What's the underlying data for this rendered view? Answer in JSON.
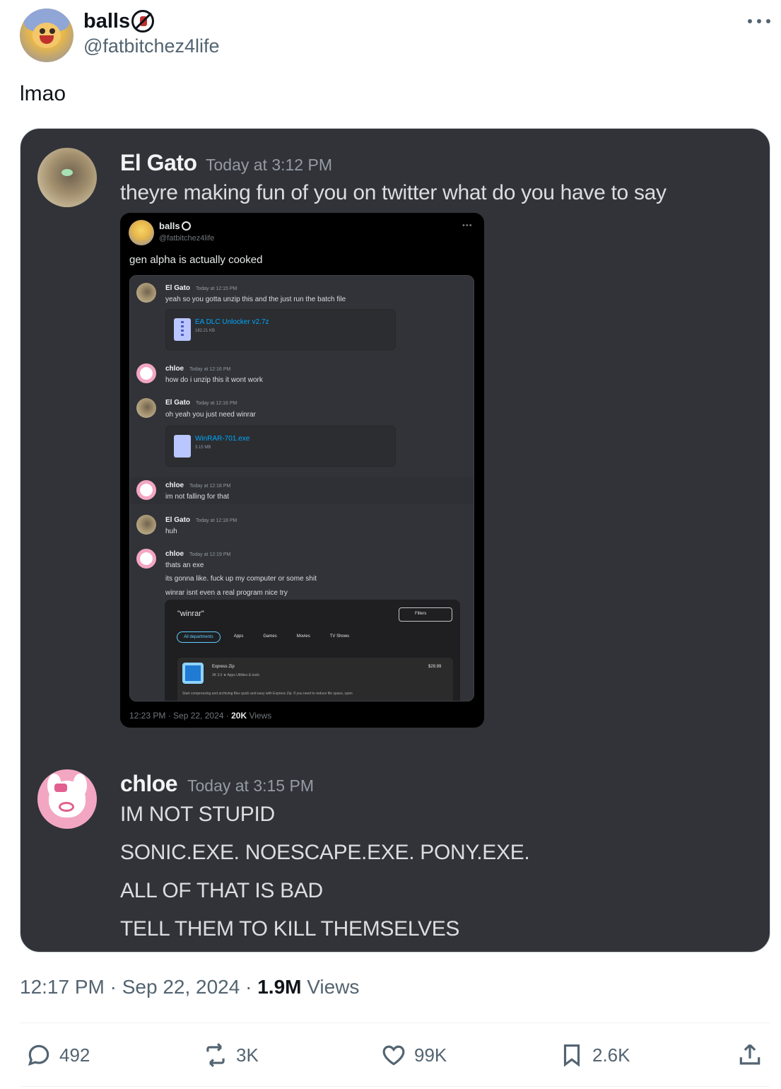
{
  "tweet": {
    "author": {
      "display_name": "balls",
      "handle": "@fatbitchez4life"
    },
    "text": "lmao",
    "timestamp": "12:17 PM · Sep 22, 2024 · ",
    "views_count": "1.9M",
    "views_label": " Views",
    "actions": {
      "replies": "492",
      "reposts": "3K",
      "likes": "99K",
      "bookmarks": "2.6K"
    }
  },
  "discord": {
    "messages": [
      {
        "author": "El Gato",
        "time": "Today at 3:12 PM",
        "lines": [
          "theyre making fun of you on twitter what do you have to say"
        ]
      },
      {
        "author": "chloe",
        "time": "Today at 3:15 PM",
        "lines": [
          "IM NOT STUPID",
          "SONIC.EXE. NOESCAPE.EXE. PONY.EXE.",
          "ALL OF THAT IS BAD",
          "TELL THEM TO KILL THEMSELVES"
        ]
      }
    ]
  },
  "nested_tweet": {
    "display_name": "balls",
    "handle": "@fatbitchez4life",
    "more": "•••",
    "text": "gen alpha is actually cooked",
    "footer_prefix": "12:23 PM · Sep 22, 2024 · ",
    "footer_views": "20K",
    "footer_suffix": " Views",
    "chat": [
      {
        "author": "El Gato",
        "time": "Today at 12:15 PM",
        "lines": [
          "yeah so you gotta unzip this and the just run the batch file"
        ]
      },
      {
        "file": "EA DLC Unlocker v2.7z",
        "size": "182.21 KB"
      },
      {
        "author": "chloe",
        "time": "Today at 12:16 PM",
        "lines": [
          "how do i unzip this it wont work"
        ]
      },
      {
        "author": "El Gato",
        "time": "Today at 12:16 PM",
        "lines": [
          "oh yeah you just need winrar"
        ]
      },
      {
        "file": "WinRAR-701.exe",
        "size": "3.15 MB"
      },
      {
        "author": "chloe",
        "time": "Today at 12:18 PM",
        "lines": [
          "im not falling for that"
        ]
      },
      {
        "author": "El Gato",
        "time": "Today at 12:18 PM",
        "lines": [
          "huh"
        ]
      },
      {
        "author": "chloe",
        "time": "Today at 12:19 PM",
        "lines": [
          "thats an exe",
          "its gonna like. fuck up my computer or some shit",
          "winrar isnt even a real program nice try"
        ]
      }
    ],
    "store": {
      "query": "\"winrar\"",
      "filters": "Filters",
      "tabs": [
        "All departments",
        "Apps",
        "Games",
        "Movies",
        "TV Shows"
      ],
      "app_name": "Express Zip",
      "app_price": "$29.99",
      "app_meta": "3K  3.0 ★  Apps  Utilities & tools",
      "app_desc": "Start compressing and archiving files quick and easy with Express Zip. If you need to reduce file space, open"
    }
  },
  "colors": {
    "media_bg": "#323338",
    "link_blue": "#00a8fc",
    "muted": "#536471"
  }
}
